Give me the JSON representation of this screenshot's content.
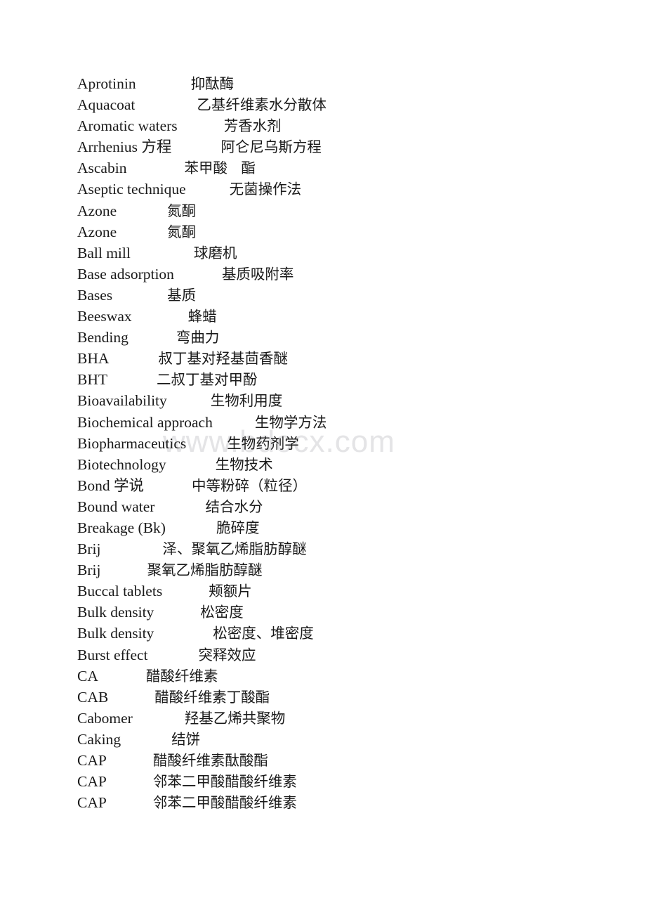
{
  "document": {
    "type": "bilingual-glossary",
    "language_pair": "English-Chinese",
    "watermark": "www.bdocx.com",
    "watermark_color": "#e4e4e6",
    "text_color": "#1a1a1a",
    "background_color": "#ffffff"
  },
  "entries": [
    {
      "term": "Aprotinin",
      "gap": 78,
      "definition": "抑酞酶"
    },
    {
      "term": "Aquacoat",
      "gap": 88,
      "definition": "乙基纤维素水分散体"
    },
    {
      "term": "Aromatic waters",
      "gap": 66,
      "definition": "芳香水剂"
    },
    {
      "term": "Arrhenius 方程",
      "gap": 70,
      "definition": "阿仑尼乌斯方程"
    },
    {
      "term": "Ascabin",
      "gap": 82,
      "definition": "苯甲酸   酯"
    },
    {
      "term": "Aseptic technique",
      "gap": 62,
      "definition": "无菌操作法"
    },
    {
      "term": "Azone",
      "gap": 72,
      "definition": "氮酮"
    },
    {
      "term": "Azone",
      "gap": 72,
      "definition": "氮酮"
    },
    {
      "term": "Ball mill",
      "gap": 90,
      "definition": "球磨机"
    },
    {
      "term": "Base adsorption",
      "gap": 68,
      "definition": "基质吸附率"
    },
    {
      "term": "Bases",
      "gap": 78,
      "definition": "基质"
    },
    {
      "term": "Beeswax",
      "gap": 80,
      "definition": "蜂蜡"
    },
    {
      "term": "Bending",
      "gap": 68,
      "definition": "弯曲力"
    },
    {
      "term": "BHA",
      "gap": 70,
      "definition": "叔丁基对羟基茴香醚"
    },
    {
      "term": "BHT",
      "gap": 70,
      "definition": "二叔丁基对甲酚"
    },
    {
      "term": "Bioavailability",
      "gap": 62,
      "definition": "生物利用度"
    },
    {
      "term": "Biochemical approach",
      "gap": 60,
      "definition": "生物学方法"
    },
    {
      "term": "Biopharmaceutics",
      "gap": 58,
      "definition": "生物药剂学"
    },
    {
      "term": "Biotechnology",
      "gap": 70,
      "definition": "生物技术"
    },
    {
      "term": "Bond 学说",
      "gap": 68,
      "definition": "中等粉碎（粒径）"
    },
    {
      "term": "Bound water",
      "gap": 72,
      "definition": "结合水分"
    },
    {
      "term": "Breakage (Bk)",
      "gap": 72,
      "definition": "脆碎度"
    },
    {
      "term": "Brij",
      "gap": 88,
      "definition": "泽、聚氧乙烯脂肪醇醚"
    },
    {
      "term": "Brij",
      "gap": 66,
      "definition": "聚氧乙烯脂肪醇醚"
    },
    {
      "term": "Buccal tablets",
      "gap": 66,
      "definition": "颊额片"
    },
    {
      "term": "Bulk density",
      "gap": 66,
      "definition": "松密度"
    },
    {
      "term": "Bulk density",
      "gap": 84,
      "definition": "松密度、堆密度"
    },
    {
      "term": "Burst effect",
      "gap": 72,
      "definition": "突释效应"
    },
    {
      "term": "CA",
      "gap": 68,
      "definition": "醋酸纤维素"
    },
    {
      "term": "CAB",
      "gap": 66,
      "definition": "醋酸纤维素丁酸酯"
    },
    {
      "term": "Cabomer",
      "gap": 74,
      "definition": "羟基乙烯共聚物"
    },
    {
      "term": "Caking",
      "gap": 72,
      "definition": "结饼"
    },
    {
      "term": "CAP",
      "gap": 66,
      "definition": "醋酸纤维素酞酸酯"
    },
    {
      "term": "CAP",
      "gap": 66,
      "definition": "邻苯二甲酸醋酸纤维素"
    },
    {
      "term": "CAP",
      "gap": 66,
      "definition": "邻苯二甲酸醋酸纤维素"
    }
  ]
}
